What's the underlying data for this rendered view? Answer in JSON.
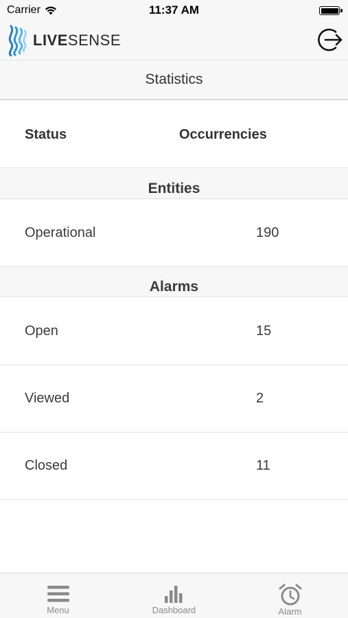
{
  "status_bar": {
    "carrier": "Carrier",
    "time": "11:37 AM"
  },
  "nav": {
    "logo_live": "LIVE",
    "logo_sense": "SENSE"
  },
  "page_title": "Statistics",
  "table_header": {
    "status": "Status",
    "occurrencies": "Occurrencies"
  },
  "sections": [
    {
      "title": "Entities",
      "rows": [
        {
          "label": "Operational",
          "value": "190"
        }
      ]
    },
    {
      "title": "Alarms",
      "rows": [
        {
          "label": "Open",
          "value": "15"
        },
        {
          "label": "Viewed",
          "value": "2"
        },
        {
          "label": "Closed",
          "value": "11"
        }
      ]
    }
  ],
  "tabs": [
    {
      "label": "Menu",
      "icon": "menu-icon"
    },
    {
      "label": "Dashboard",
      "icon": "bar-chart-icon"
    },
    {
      "label": "Alarm",
      "icon": "alarm-clock-icon"
    }
  ],
  "colors": {
    "logo_blue": "#1d7fc1",
    "text": "#333333",
    "tab_icon": "#8a8a8a",
    "bar_background": "#f7f7f7"
  }
}
